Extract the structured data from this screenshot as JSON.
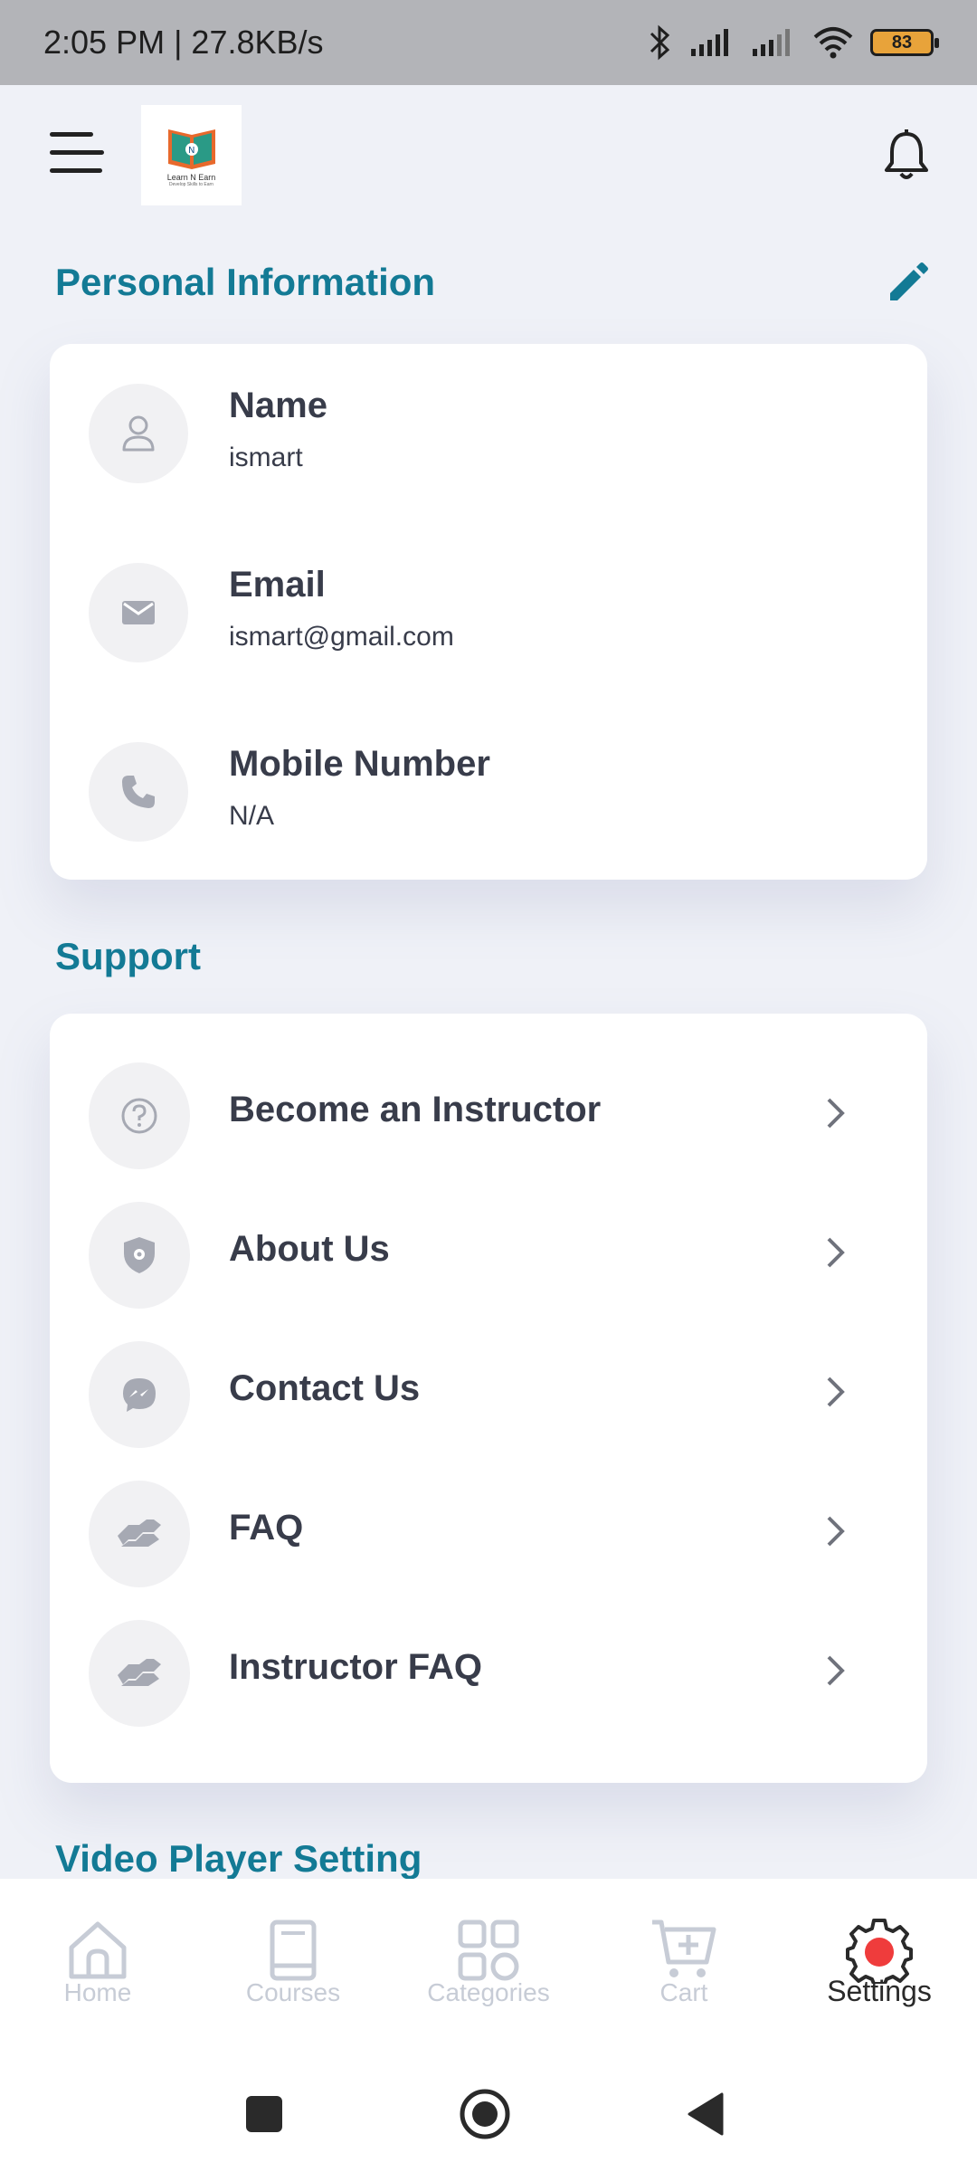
{
  "status_bar": {
    "time_speed": "2:05 PM | 27.8KB/s",
    "battery": "83"
  },
  "app": {
    "logo_title": "Learn N Earn",
    "logo_subtitle": "Develop Skills to Earn"
  },
  "personal": {
    "title": "Personal Information",
    "rows": [
      {
        "label": "Name",
        "value": "ismart",
        "icon": "user-icon"
      },
      {
        "label": "Email",
        "value": "ismart@gmail.com",
        "icon": "mail-icon"
      },
      {
        "label": "Mobile Number",
        "value": "N/A",
        "icon": "phone-icon"
      }
    ]
  },
  "support": {
    "title": "Support",
    "items": [
      {
        "label": "Become an Instructor",
        "icon": "question-icon"
      },
      {
        "label": "About Us",
        "icon": "shield-icon"
      },
      {
        "label": "Contact Us",
        "icon": "messenger-icon"
      },
      {
        "label": "FAQ",
        "icon": "handshake-icon"
      },
      {
        "label": "Instructor FAQ",
        "icon": "handshake-icon"
      }
    ]
  },
  "video": {
    "title": "Video Player Setting"
  },
  "bottom_nav": {
    "items": [
      {
        "label": "Home",
        "icon": "home-icon",
        "active": false
      },
      {
        "label": "Courses",
        "icon": "book-icon",
        "active": false
      },
      {
        "label": "Categories",
        "icon": "grid-icon",
        "active": false
      },
      {
        "label": "Cart",
        "icon": "cart-icon",
        "active": false
      },
      {
        "label": "Settings",
        "icon": "gear-icon",
        "active": true
      }
    ]
  },
  "colors": {
    "accent": "#137a95",
    "background": "#eff1f7",
    "text": "#383c4a",
    "active_dot": "#ef3c3c",
    "inactive_nav": "#c7ccd6"
  }
}
